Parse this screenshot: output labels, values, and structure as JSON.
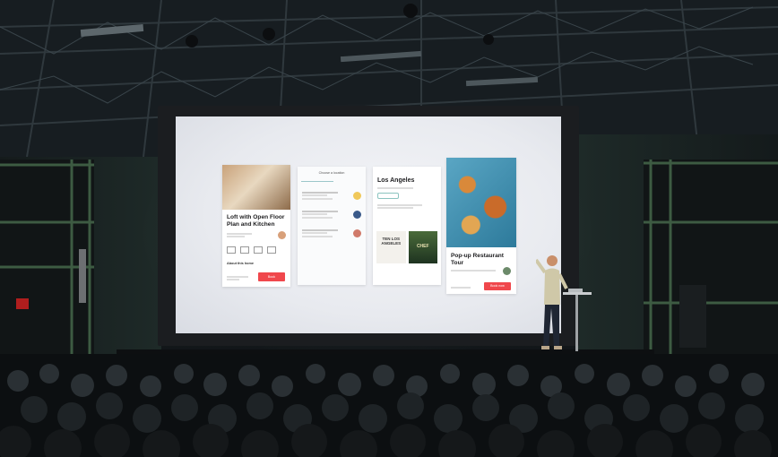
{
  "screen": {
    "card1": {
      "title": "Loft with Open Floor Plan and Kitchen",
      "section": "About this home",
      "button": "Book"
    },
    "card2": {
      "header": "Choose a location"
    },
    "card3": {
      "title": "Los Angeles",
      "book1_title": "TEN LOS ANGELES",
      "book2_title": "CHEF"
    },
    "card4": {
      "title": "Pop-up Restaurant Tour",
      "button": "Book now"
    }
  },
  "colors": {
    "accent": "#f0474c",
    "screen": "#eef0f4",
    "venue": "#1b2226"
  }
}
